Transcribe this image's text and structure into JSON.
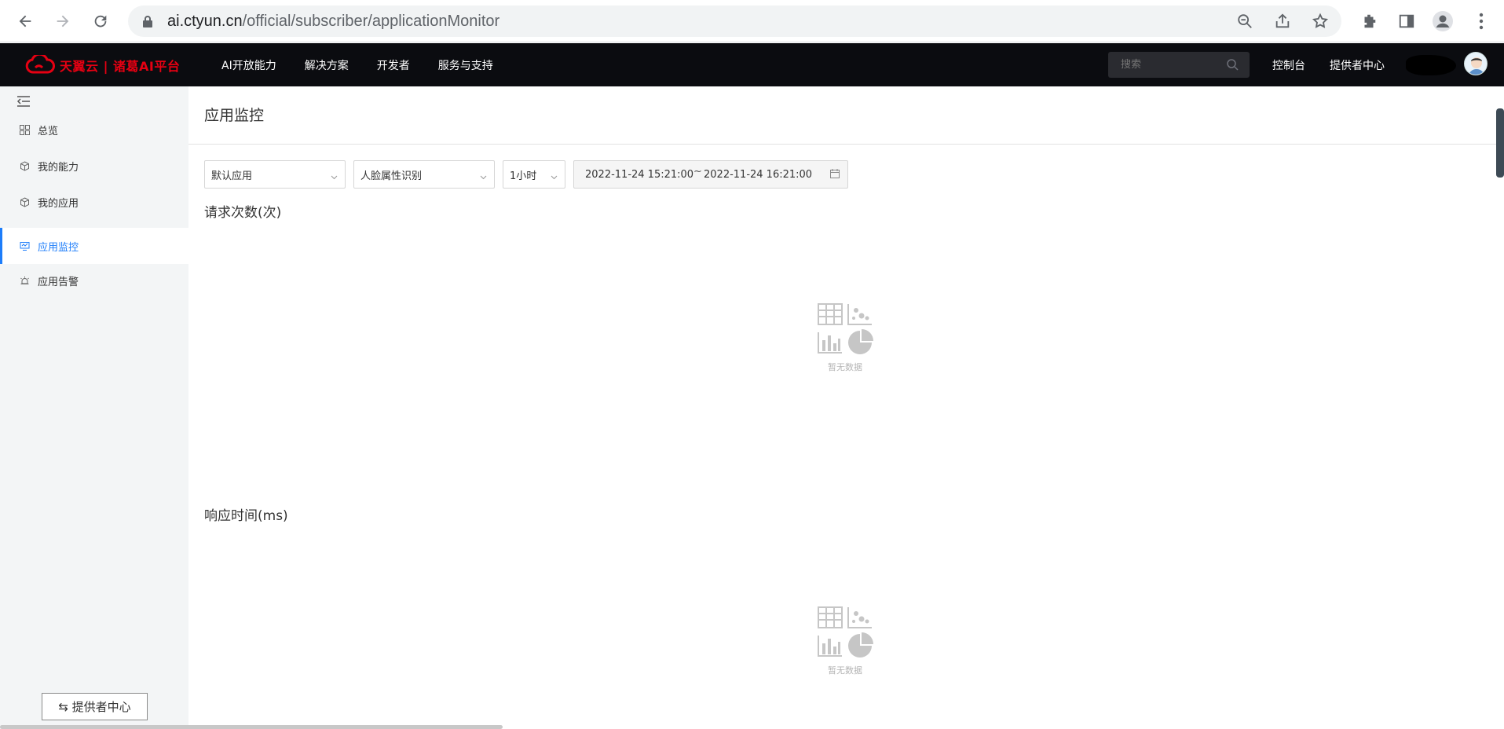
{
  "browser": {
    "url_host": "ai.ctyun.cn",
    "url_path": "/official/subscriber/applicationMonitor"
  },
  "topnav": {
    "logo_text": "天翼云 | 诸葛AI平台",
    "menu": [
      "AI开放能力",
      "解决方案",
      "开发者",
      "服务与支持"
    ],
    "search_placeholder": "搜索",
    "console_label": "控制台",
    "provider_center_label": "提供者中心"
  },
  "sidebar": {
    "items": [
      {
        "label": "总览",
        "icon": "grid-icon"
      },
      {
        "label": "我的能力",
        "icon": "cube-icon"
      },
      {
        "label": "我的应用",
        "icon": "cube-icon"
      },
      {
        "label": "应用监控",
        "icon": "monitor-icon",
        "active": true
      },
      {
        "label": "应用告警",
        "icon": "alarm-icon"
      }
    ],
    "provider_button": "⇆ 提供者中心"
  },
  "main": {
    "title": "应用监控",
    "filters": {
      "app": "默认应用",
      "capability": "人脸属性识别",
      "period": "1小时",
      "start": "2022-11-24 15:21:00",
      "separator": "~",
      "end": "2022-11-24 16:21:00"
    },
    "sections": [
      {
        "title": "请求次数(次)",
        "empty_text": "暂无数据"
      },
      {
        "title": "响应时间(ms)",
        "empty_text": "暂无数据"
      }
    ]
  },
  "colors": {
    "accent": "#1d7dfa",
    "brand_red": "#e60012",
    "topnav_bg": "#0b0c10",
    "sidebar_bg": "#f3f5f6"
  }
}
